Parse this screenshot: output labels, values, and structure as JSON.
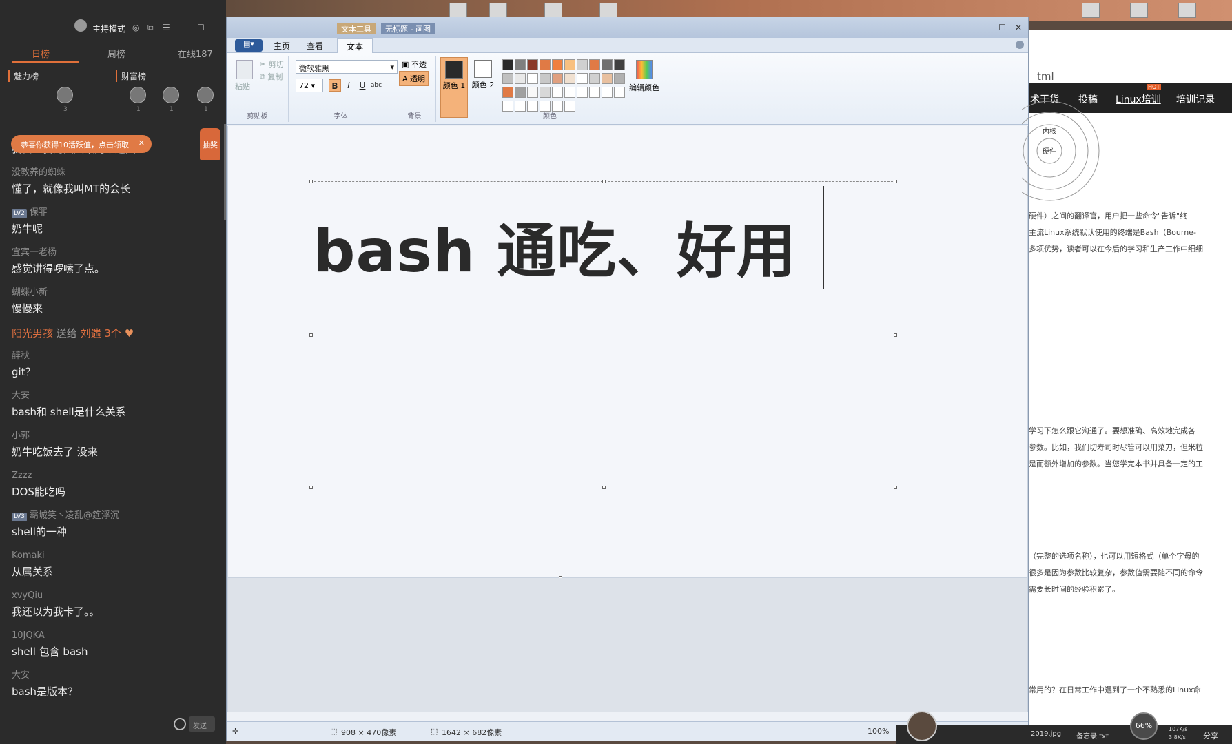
{
  "live": {
    "host_mode": "主持模式",
    "tabs": [
      "日榜",
      "周榜",
      "在线187"
    ],
    "rank_headers": [
      "魅力榜",
      "财富榜"
    ],
    "rank_counts": [
      "3",
      "1",
      "1",
      "1"
    ],
    "gift_toast": "恭喜你获得10活跃值，点击领取",
    "lottery": "抽奖",
    "send_placeholder": "发送",
    "messages": [
      {
        "user": "我要砸我的大凤梨两个通天",
        "text": ""
      },
      {
        "user": "没教养的蜘蛛",
        "text": "懂了，就像我叫MT的会长"
      },
      {
        "user": "保罪",
        "badge": "LV2",
        "text": "奶牛呢"
      },
      {
        "user": "宜宾一老杨",
        "text": "感觉讲得啰嗦了点。"
      },
      {
        "user": "蝴蝶小新",
        "text": "慢慢来"
      },
      {
        "gift": true,
        "from": "阳光男孩",
        "mid": "送给",
        "to": "刘遄",
        "count": "3个"
      },
      {
        "user": "醉秋",
        "text": "git？"
      },
      {
        "user": "大安",
        "text": "bash和 shell是什么关系"
      },
      {
        "user": "小郭",
        "text": "奶牛吃饭去了 没来"
      },
      {
        "user": "Zzzz",
        "text": "DOS能吃吗"
      },
      {
        "user": "霸城笑丶凌乱@筵浮沉",
        "badge": "LV3",
        "text": "shell的一种"
      },
      {
        "user": "Komaki",
        "text": "从属关系"
      },
      {
        "user": "xvyQiu",
        "text": "我还以为我卡了。。"
      },
      {
        "user": "10JQKA",
        "text": "shell 包含 bash"
      },
      {
        "user": "大安",
        "text": "bash是版本？"
      }
    ]
  },
  "paint": {
    "title_tabs": [
      "文本工具",
      "无标题 - 画图"
    ],
    "file_btn": "▤▾",
    "tabs": [
      "主页",
      "查看",
      "文本"
    ],
    "clipboard": {
      "paste": "粘贴",
      "cut": "剪切",
      "copy": "复制",
      "label": "剪贴板"
    },
    "font": {
      "name": "微软雅黑",
      "size": "72",
      "bold": "B",
      "italic": "I",
      "underline": "U",
      "strike": "abc",
      "label": "字体"
    },
    "background": {
      "opaque": "不透明",
      "transparent": "透明",
      "label": "背景"
    },
    "colors": {
      "color1": "颜色 1",
      "color2": "颜色 2",
      "edit": "编辑颜色",
      "label": "颜色",
      "color1_value": "#2a2a2a",
      "color2_value": "#ffffff"
    },
    "palette": [
      "#2a2a2a",
      "#7f7f7f",
      "#8a3a2a",
      "#e07a45",
      "#f08040",
      "#f8c080",
      "#d0d0d0",
      "#e07a45",
      "#707070",
      "#404040",
      "#c0c0c0",
      "#e8e8e8",
      "#ffffff",
      "#c8c8c8",
      "#e0a080",
      "#f0e0d0",
      "#ffffff",
      "#d0d0d0",
      "#e8c0a0",
      "#b0b0b0",
      "#e07a45",
      "#a0a0a0",
      "#f8f8f8",
      "#d8d8d8",
      "#ffffff",
      "#ffffff",
      "#ffffff",
      "#ffffff",
      "#ffffff",
      "#ffffff",
      "#ffffff",
      "#ffffff",
      "#ffffff",
      "#ffffff",
      "#ffffff",
      "#ffffff"
    ],
    "canvas_text": "bash  通吃、好用",
    "status": {
      "selection": "908 × 470像素",
      "size": "1642 × 682像素",
      "zoom": "100%"
    }
  },
  "browser": {
    "url_fragment": "tml",
    "nav": [
      "术干货",
      "投稿",
      "Linux培训",
      "培训记录"
    ],
    "hot": "HOT",
    "diagram_labels": [
      "内核",
      "硬件"
    ],
    "paras": [
      "硬件）之间的翻译官，用户把一些命令\"告诉\"终",
      "主流Linux系统默认使用的终端是Bash（Bourne-",
      "多项优势，读者可以在今后的学习和生产工作中细细",
      "学习下怎么跟它沟通了。要想准确、高效地完成各",
      "参数。比如，我们切寿司时尽管可以用菜刀，但米粒",
      "是而额外增加的参数。当您学完本书并具备一定的工",
      "（完整的选项名称），也可以用短格式（单个字母的",
      "很多是因为参数比较复杂，参数值需要随不同的命令",
      "需要长时间的经验积累了。",
      "常用的？在日常工作中遇到了一个不熟悉的Linux命"
    ]
  },
  "taskbar": {
    "file": "2019.jpg",
    "note": "备忘录.txt",
    "cpu": "66%",
    "net_up": "107K/s",
    "net_down": "3.8K/s",
    "share": "分享"
  }
}
